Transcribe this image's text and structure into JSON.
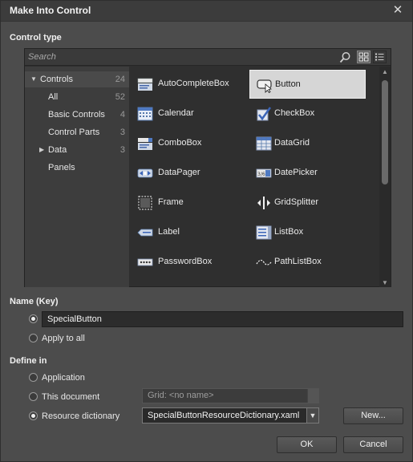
{
  "dialog": {
    "title": "Make Into Control",
    "close_glyph": "✕"
  },
  "control_type": {
    "label": "Control type",
    "search_placeholder": "Search",
    "categories": [
      {
        "label": "Controls",
        "count": "24",
        "expanded": true
      },
      {
        "label": "All",
        "count": "52"
      },
      {
        "label": "Basic Controls",
        "count": "4"
      },
      {
        "label": "Control Parts",
        "count": "3"
      },
      {
        "label": "Data",
        "count": "3",
        "collapsed": true
      },
      {
        "label": "Panels",
        "count": ""
      }
    ],
    "controls": [
      {
        "label": "AutoCompleteBox",
        "icon": "autocompletebox-icon"
      },
      {
        "label": "Button",
        "icon": "button-icon",
        "selected": true
      },
      {
        "label": "Calendar",
        "icon": "calendar-icon"
      },
      {
        "label": "CheckBox",
        "icon": "checkbox-icon"
      },
      {
        "label": "ComboBox",
        "icon": "combobox-icon"
      },
      {
        "label": "DataGrid",
        "icon": "datagrid-icon"
      },
      {
        "label": "DataPager",
        "icon": "datapager-icon"
      },
      {
        "label": "DatePicker",
        "icon": "datepicker-icon"
      },
      {
        "label": "Frame",
        "icon": "frame-icon"
      },
      {
        "label": "GridSplitter",
        "icon": "gridsplitter-icon"
      },
      {
        "label": "Label",
        "icon": "label-icon"
      },
      {
        "label": "ListBox",
        "icon": "listbox-icon"
      },
      {
        "label": "PasswordBox",
        "icon": "passwordbox-icon"
      },
      {
        "label": "PathListBox",
        "icon": "pathlistbox-icon"
      }
    ]
  },
  "name_key": {
    "label": "Name (Key)",
    "value": "SpecialButton",
    "apply_to_all": "Apply to all"
  },
  "define_in": {
    "label": "Define in",
    "application": "Application",
    "this_document": "This document",
    "resource_dictionary": "Resource dictionary",
    "grid_placeholder": "Grid: <no name>",
    "dictionary_value": "SpecialButtonResourceDictionary.xaml",
    "new_button": "New..."
  },
  "buttons": {
    "ok": "OK",
    "cancel": "Cancel"
  },
  "colors": {
    "background": "#4c4c4c",
    "panel": "#2f2f2f",
    "selection": "#d6d6d6"
  }
}
